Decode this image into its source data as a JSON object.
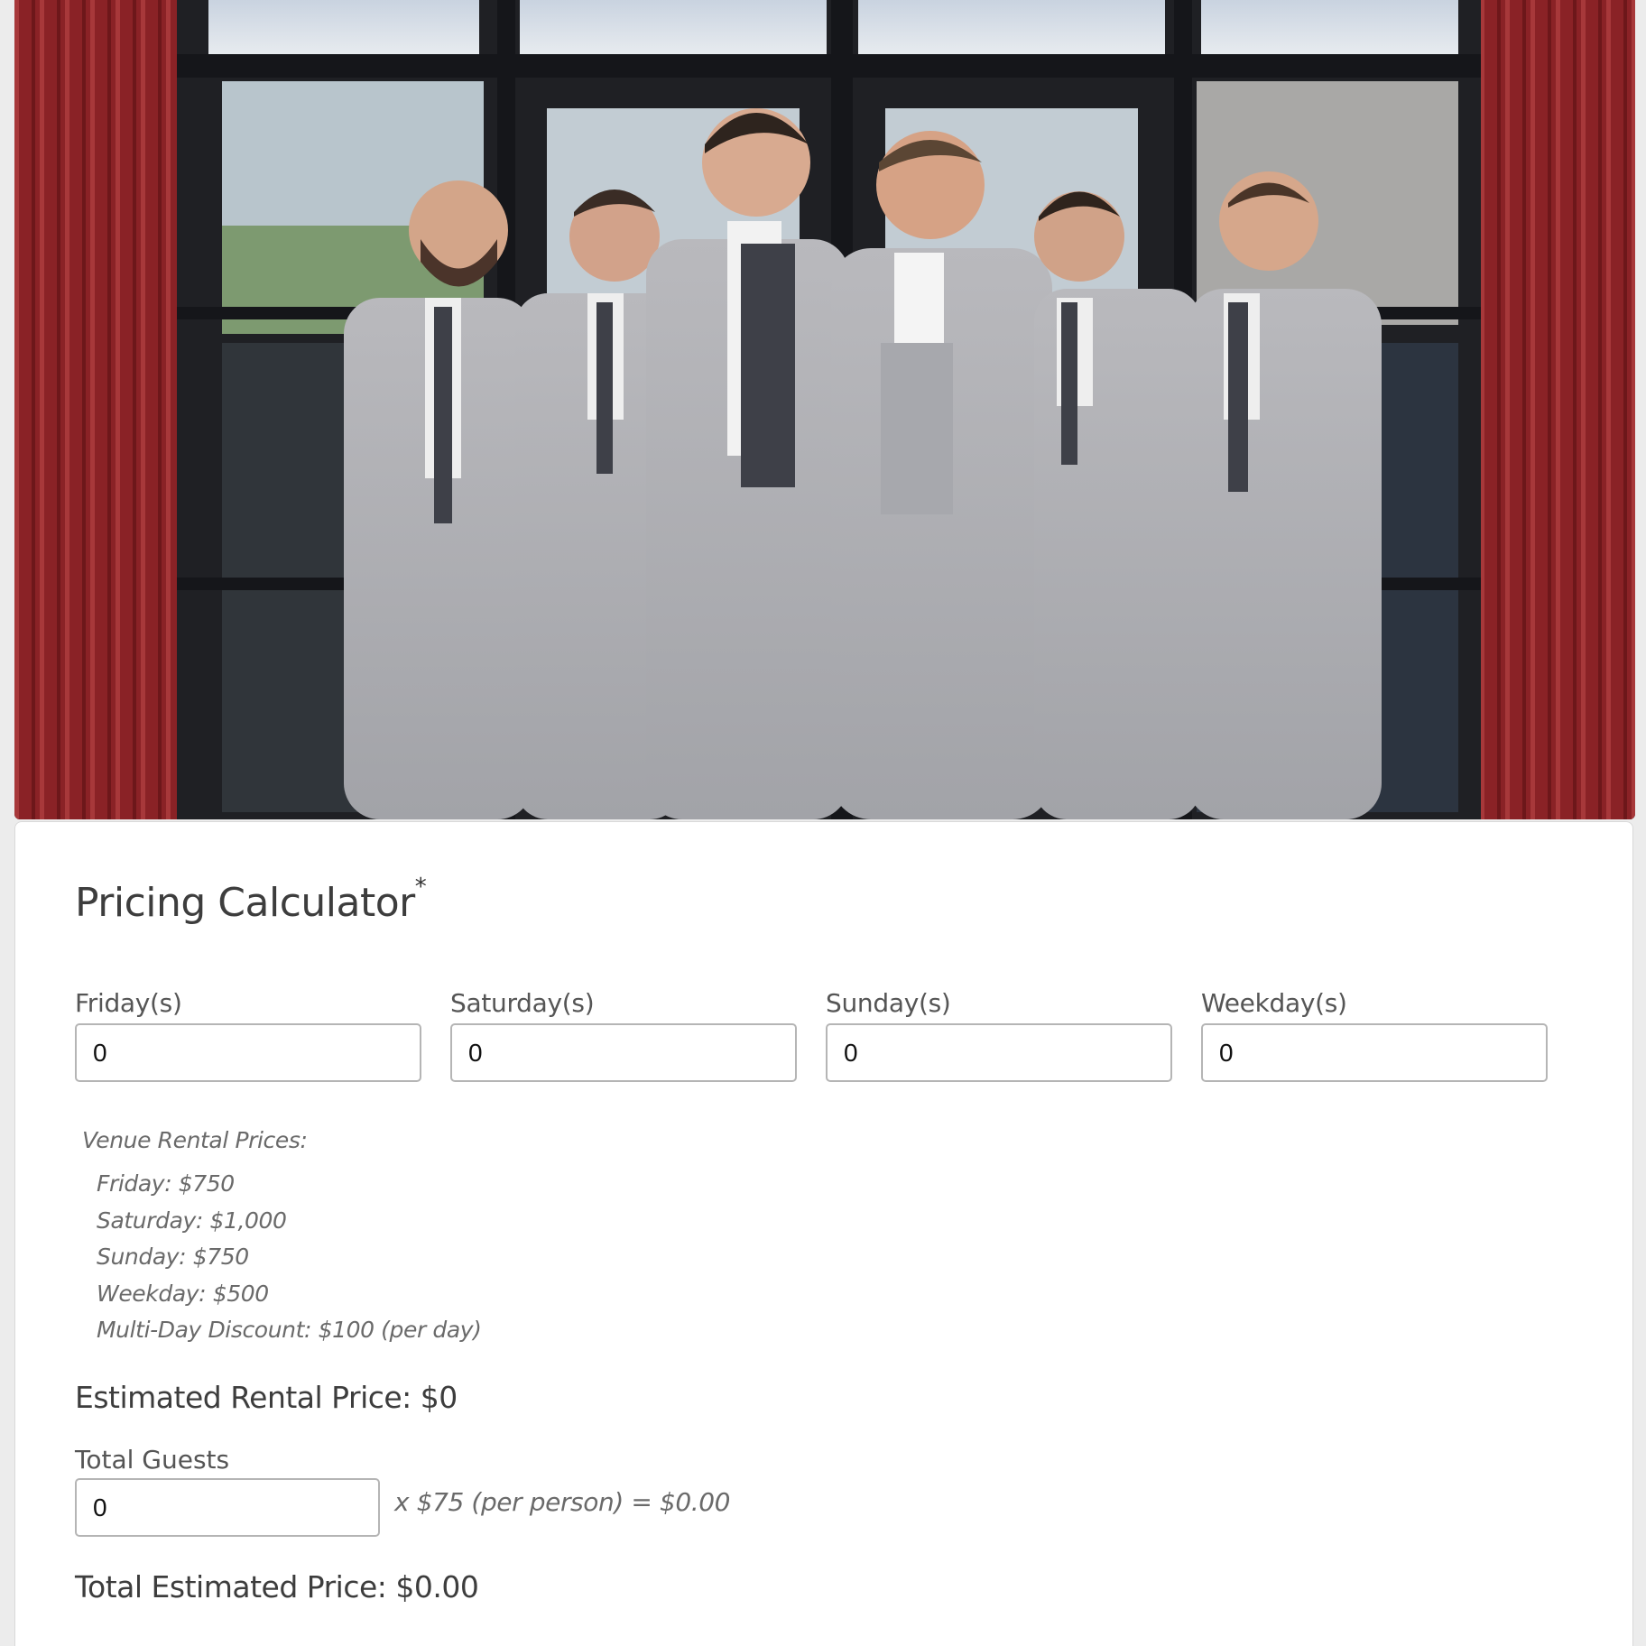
{
  "hero": {
    "description_icon": "groomsmen-photo"
  },
  "form": {
    "title": "Pricing Calculator",
    "required_marker": "*",
    "fields": [
      {
        "label": "Friday(s)",
        "value": "0"
      },
      {
        "label": "Saturday(s)",
        "value": "0"
      },
      {
        "label": "Sunday(s)",
        "value": "0"
      },
      {
        "label": "Weekday(s)",
        "value": "0"
      }
    ],
    "prices": {
      "heading": "Venue Rental Prices:",
      "items": [
        "Friday: $750",
        "Saturday: $1,000",
        "Sunday: $750",
        "Weekday: $500",
        "Multi-Day Discount: $100 (per day)"
      ]
    },
    "estimated_rental": "Estimated Rental Price: $0",
    "guests": {
      "label": "Total Guests",
      "value": "0",
      "calc": "x $75 (per person) = $0.00"
    },
    "total": "Total Estimated Price: $0.00"
  }
}
